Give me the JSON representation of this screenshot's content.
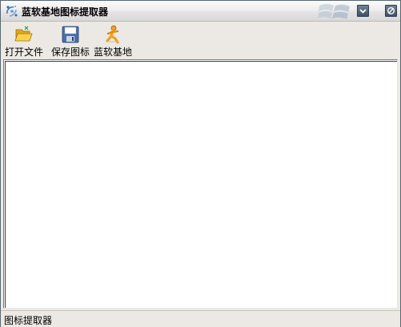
{
  "window": {
    "title": "蓝软基地图标提取器"
  },
  "icons": {
    "app": "app-logo-icon",
    "minimize": "chevron-down-icon",
    "close": "close-circle-icon",
    "open": "open-folder-icon",
    "save": "floppy-disk-icon",
    "site": "running-man-icon"
  },
  "toolbar": {
    "open_label": "打开文件",
    "save_label": "保存图标",
    "site_label": "蓝软基地"
  },
  "statusbar": {
    "text": "图标提取器"
  },
  "colors": {
    "window_bg": "#ece9e4",
    "titlebar_button": "#4a5e72",
    "content_bg": "#ffffff"
  }
}
